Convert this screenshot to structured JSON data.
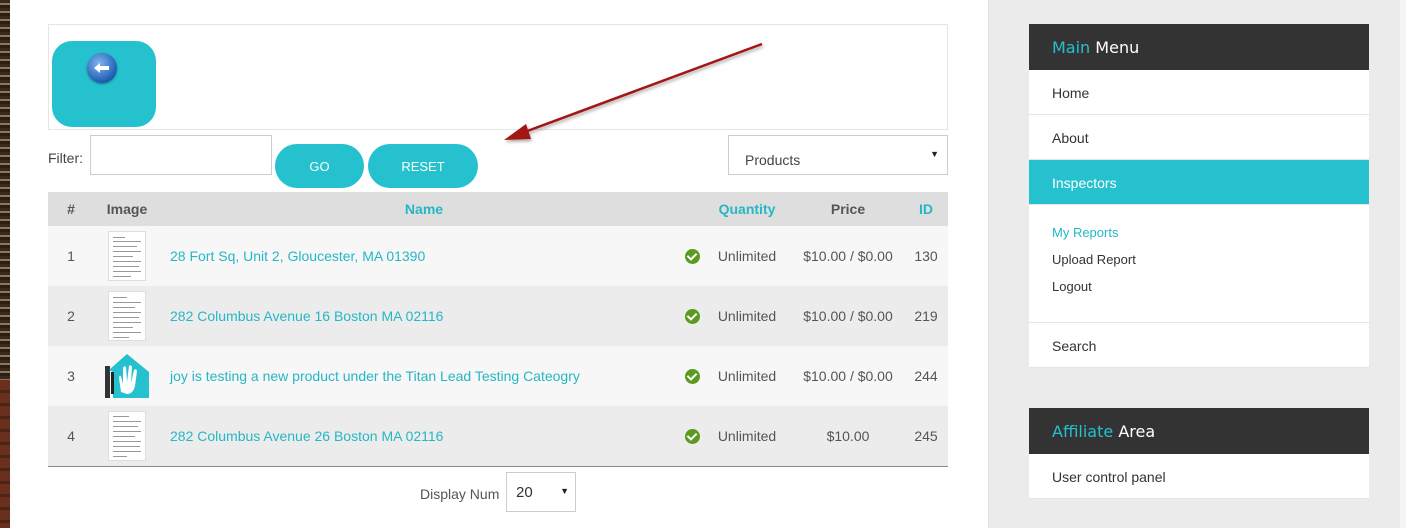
{
  "filter": {
    "label": "Filter:",
    "value": "",
    "go_label": "GO",
    "reset_label": "RESET",
    "category_selected": "Products"
  },
  "table": {
    "headers": {
      "num": "#",
      "image": "Image",
      "name": "Name",
      "quantity": "Quantity",
      "price": "Price",
      "id": "ID"
    },
    "rows": [
      {
        "num": "1",
        "name": "28 Fort Sq, Unit 2, Gloucester, MA 01390",
        "quantity": "Unlimited",
        "price": "$10.00 / $0.00",
        "id": "130",
        "image": "document-thumbnail"
      },
      {
        "num": "2",
        "name": "282 Columbus Avenue 16 Boston MA 02116",
        "quantity": "Unlimited",
        "price": "$10.00 / $0.00",
        "id": "219",
        "image": "document-thumbnail"
      },
      {
        "num": "3",
        "name": "joy is testing a new product under the Titan Lead Testing Cateogry",
        "quantity": "Unlimited",
        "price": "$10.00 / $0.00",
        "id": "244",
        "image": "house-hands-logo"
      },
      {
        "num": "4",
        "name": "282 Columbus Avenue 26 Boston MA 02116",
        "quantity": "Unlimited",
        "price": "$10.00",
        "id": "245",
        "image": "document-thumbnail"
      }
    ]
  },
  "pagination": {
    "display_label": "Display Num",
    "display_value": "20"
  },
  "sidebar": {
    "main_menu": {
      "title_accent": "Main",
      "title_rest": " Menu",
      "items": [
        {
          "label": "Home"
        },
        {
          "label": "About"
        },
        {
          "label": "Inspectors"
        }
      ],
      "sub_items": [
        {
          "label": "My Reports"
        },
        {
          "label": "Upload Report"
        },
        {
          "label": "Logout"
        }
      ],
      "search_label": "Search"
    },
    "affiliate": {
      "title_accent": "Affiliate",
      "title_rest": " Area",
      "items": [
        {
          "label": "User control panel"
        }
      ]
    }
  },
  "colors": {
    "accent": "#25c1cf",
    "header_dark": "#333333",
    "annotation_arrow": "#a31515",
    "check_green": "#5a9a1f"
  },
  "icons": {
    "back": "back-arrow-icon",
    "check": "check-circle-icon",
    "caret": "caret-down-icon"
  }
}
